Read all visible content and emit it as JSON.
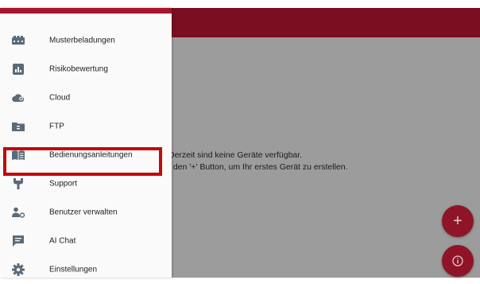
{
  "menu": {
    "items": [
      {
        "label": "Musterbeladungen",
        "icon": "load-pattern-icon"
      },
      {
        "label": "Risikobewertung",
        "icon": "risk-assessment-icon"
      },
      {
        "label": "Cloud",
        "icon": "cloud-icon"
      },
      {
        "label": "FTP",
        "icon": "ftp-folder-icon"
      },
      {
        "label": "Bedienungsanleitungen",
        "icon": "manual-book-icon"
      },
      {
        "label": "Support",
        "icon": "wrench-icon"
      },
      {
        "label": "Benutzer verwalten",
        "icon": "user-settings-icon"
      },
      {
        "label": "AI Chat",
        "icon": "chat-icon"
      },
      {
        "label": "Einstellungen",
        "icon": "gear-icon"
      }
    ]
  },
  "main": {
    "empty_line1": "Derzeit sind keine Geräte verfügbar.",
    "empty_line2": "f den '+' Button, um Ihr erstes Gerät zu erstellen."
  },
  "fab": {
    "add_symbol": "+"
  },
  "colors": {
    "appbar": "#7a0f21",
    "fab": "#8f1427",
    "highlight": "#c10a0a",
    "drawer_accent": "#a8142c"
  }
}
